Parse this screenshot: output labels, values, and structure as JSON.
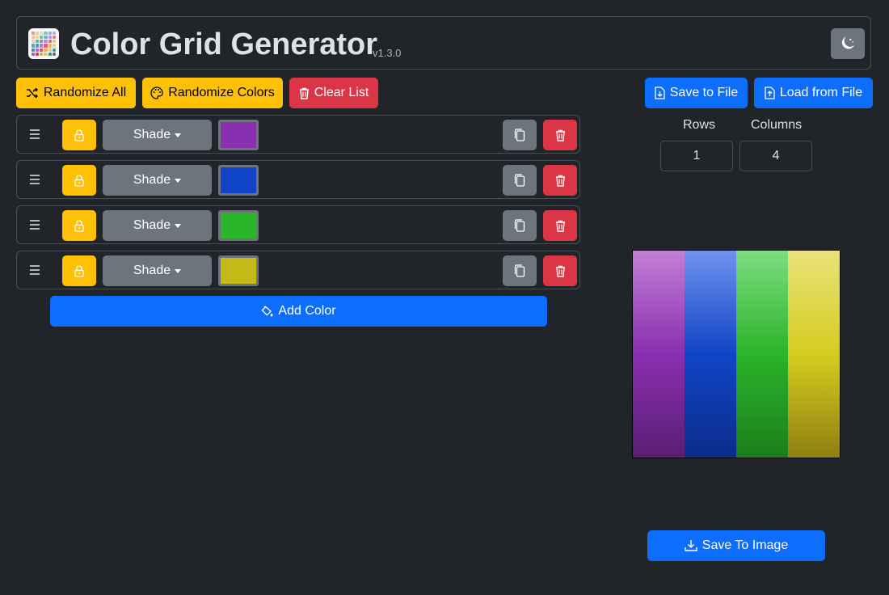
{
  "header": {
    "title": "Color Grid Generator",
    "version": "v1.3.0",
    "theme_icon": "moon-stars-icon"
  },
  "toolbar": {
    "randomize_all": "Randomize All",
    "randomize_colors": "Randomize Colors",
    "clear_list": "Clear List",
    "save_to_file": "Save to File",
    "load_from_file": "Load from File"
  },
  "color_rows": [
    {
      "mode": "Shade",
      "color": "#8a2fb0"
    },
    {
      "mode": "Shade",
      "color": "#1144c8"
    },
    {
      "mode": "Shade",
      "color": "#2ab52a"
    },
    {
      "mode": "Shade",
      "color": "#c4b917"
    }
  ],
  "add_color": "Add Color",
  "grid_settings": {
    "rows_label": "Rows",
    "columns_label": "Columns",
    "rows_value": "1",
    "columns_value": "4"
  },
  "preview": {
    "cells": [
      {
        "top": "#c27fd6",
        "mid": "#8a2fb0",
        "bottom": "#5a1e74"
      },
      {
        "top": "#6f92ec",
        "mid": "#1144c8",
        "bottom": "#0a2d8a"
      },
      {
        "top": "#7fdc7f",
        "mid": "#2ab52a",
        "bottom": "#1b7d1b"
      },
      {
        "top": "#e8e27a",
        "mid": "#d6cc1f",
        "bottom": "#8f7f12"
      }
    ]
  },
  "save_image": "Save To Image",
  "colors": {
    "background": "#212529",
    "warning": "#ffc107",
    "danger": "#dc3545",
    "primary": "#0d6efd",
    "secondary": "#6c757d"
  }
}
